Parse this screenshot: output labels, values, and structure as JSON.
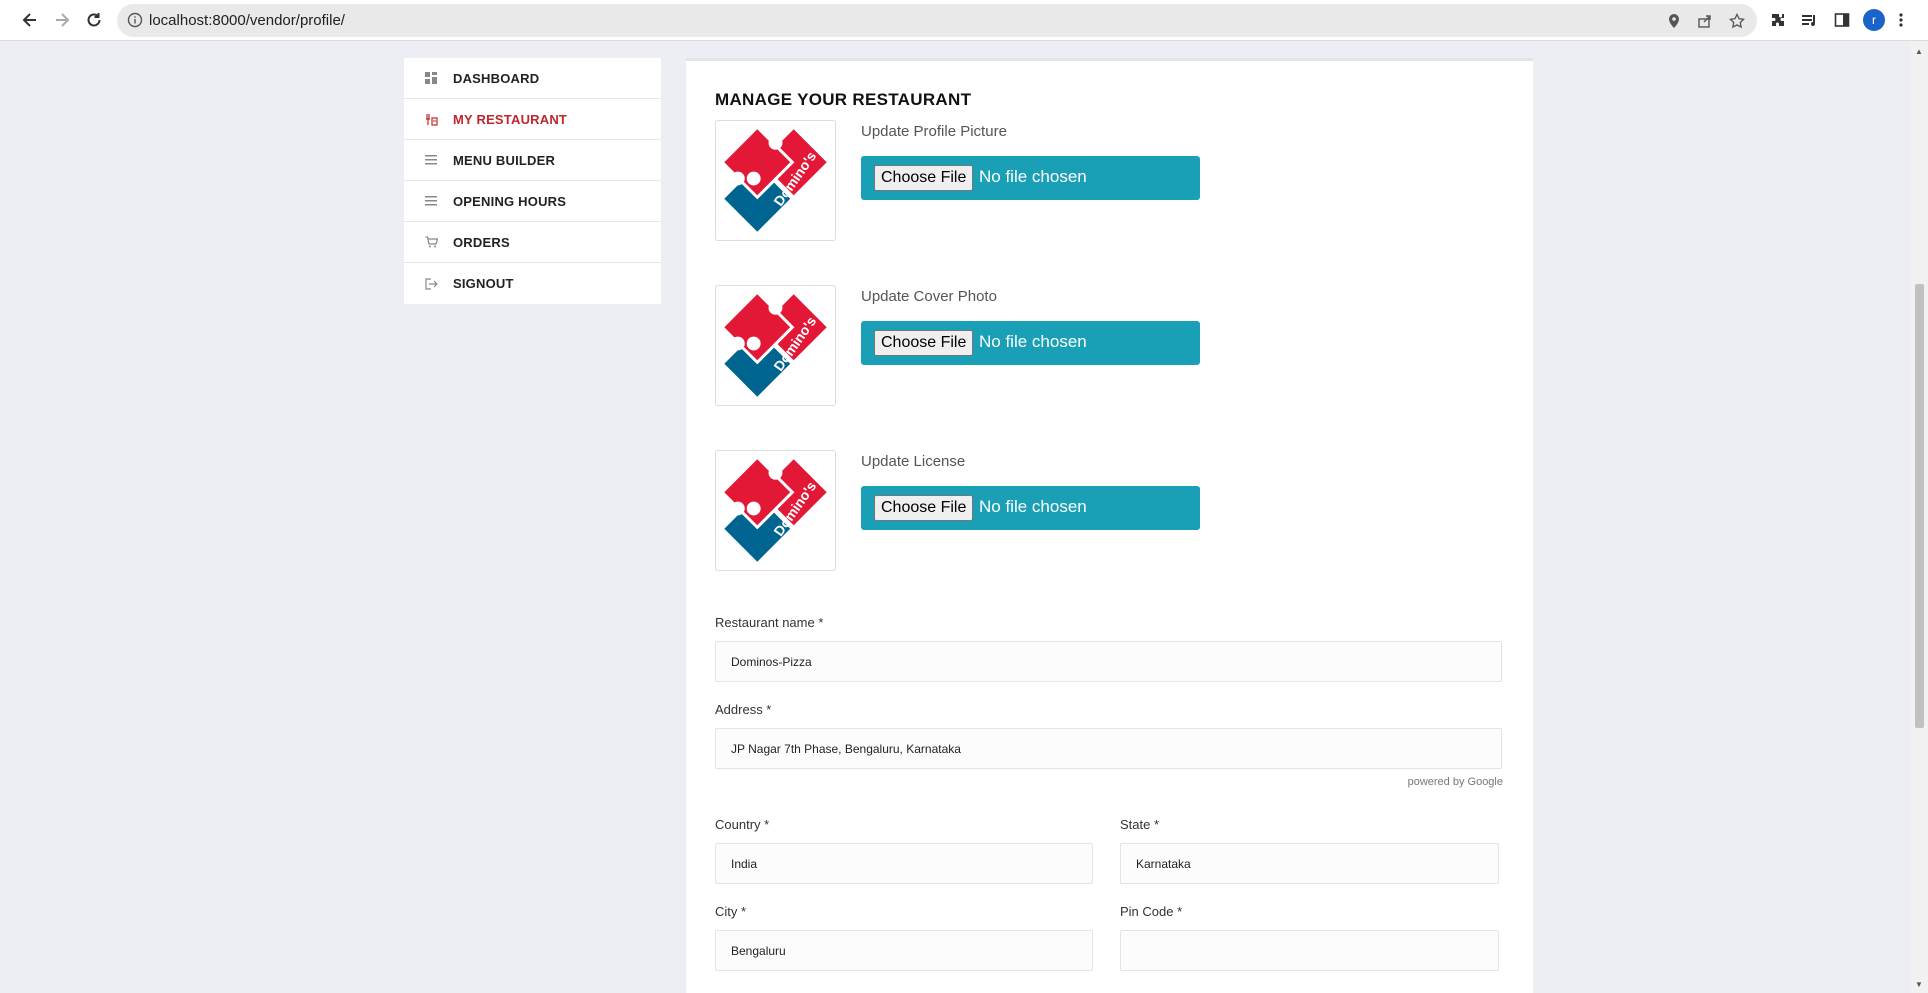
{
  "browser": {
    "url": "localhost:8000/vendor/profile/",
    "avatar_letter": "r"
  },
  "sidebar": {
    "items": [
      {
        "label": "DASHBOARD",
        "icon": "dashboard-icon"
      },
      {
        "label": "MY RESTAURANT",
        "icon": "restaurant-icon",
        "active": true
      },
      {
        "label": "MENU BUILDER",
        "icon": "list-icon"
      },
      {
        "label": "OPENING HOURS",
        "icon": "list-icon"
      },
      {
        "label": "ORDERS",
        "icon": "cart-icon"
      },
      {
        "label": "SIGNOUT",
        "icon": "signout-icon"
      }
    ]
  },
  "main": {
    "title": "MANAGE YOUR RESTAURANT",
    "uploads": [
      {
        "label": "Update Profile Picture",
        "button": "Choose File",
        "status": "No file chosen"
      },
      {
        "label": "Update Cover Photo",
        "button": "Choose File",
        "status": "No file chosen"
      },
      {
        "label": "Update License",
        "button": "Choose File",
        "status": "No file chosen"
      }
    ],
    "logo_text": "Domino's Pizza",
    "fields": {
      "restaurant_name": {
        "label": "Restaurant name *",
        "value": "Dominos-Pizza"
      },
      "address": {
        "label": "Address *",
        "value": "JP Nagar 7th Phase, Bengaluru, Karnataka"
      },
      "powered_by": "powered by Google",
      "country": {
        "label": "Country *",
        "value": "India"
      },
      "state": {
        "label": "State *",
        "value": "Karnataka"
      },
      "city": {
        "label": "City *",
        "value": "Bengaluru"
      },
      "pin_code": {
        "label": "Pin Code *",
        "value": ""
      }
    }
  },
  "colors": {
    "accent_upload": "#1aa0b6",
    "active_nav": "#c0262d",
    "page_bg": "#eceef3",
    "domino_red": "#e31837",
    "domino_blue": "#006491"
  }
}
